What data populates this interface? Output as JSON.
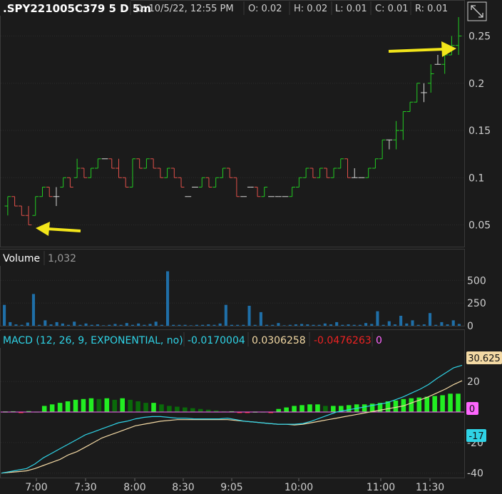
{
  "header": {
    "symbol": ".SPY221005C379 5 D 5m",
    "date": "D: 10/5/22, 12:55 PM",
    "open": "O: 0.02",
    "high": "H: 0.02",
    "low": "L: 0.01",
    "close": "C: 0.01",
    "range": "R: 0.01"
  },
  "volume_header": {
    "label": "Volume",
    "value": "1,032"
  },
  "macd_header": {
    "label": "MACD (12, 26, 9, EXPONENTIAL, no)",
    "value": "-0.0170004",
    "avg": "0.0306258",
    "diff": "-0.0476263",
    "zero": "0"
  },
  "macd_badges": {
    "top": "30.625",
    "zero": "0",
    "bottom": "-17"
  },
  "x_ticks": [
    "7:00",
    "7:30",
    "8:00",
    "8:30",
    "9:05",
    "10:00",
    "11:00",
    "11:30"
  ],
  "colors": {
    "up": "#22cc22",
    "down": "#e0504a",
    "neutral": "#d8d8d8",
    "volume": "#1f6fa8",
    "macd_value": "#2fd3e6",
    "macd_avg": "#f3d9a4",
    "arrow": "#f2e51a",
    "hist_pos": "#22ee22",
    "hist_pos_fall": "#0a6a0a",
    "hist_neg": "#ee2222",
    "zero_line": "#ff66ff"
  },
  "chart_data": [
    {
      "type": "candlestick",
      "name": "price",
      "ylim": [
        0.03,
        0.27
      ],
      "yticks": [
        0.05,
        0.1,
        0.15,
        0.2,
        0.25
      ],
      "bars": [
        {
          "o": 0.07,
          "h": 0.08,
          "l": 0.06,
          "c": 0.08
        },
        {
          "o": 0.08,
          "h": 0.08,
          "l": 0.07,
          "c": 0.07
        },
        {
          "o": 0.07,
          "h": 0.07,
          "l": 0.06,
          "c": 0.06
        },
        {
          "o": 0.06,
          "h": 0.07,
          "l": 0.05,
          "c": 0.05
        },
        {
          "o": 0.06,
          "h": 0.08,
          "l": 0.06,
          "c": 0.08
        },
        {
          "o": 0.08,
          "h": 0.09,
          "l": 0.08,
          "c": 0.09
        },
        {
          "o": 0.09,
          "h": 0.09,
          "l": 0.08,
          "c": 0.08
        },
        {
          "o": 0.08,
          "h": 0.09,
          "l": 0.07,
          "c": 0.08
        },
        {
          "o": 0.09,
          "h": 0.1,
          "l": 0.09,
          "c": 0.1
        },
        {
          "o": 0.1,
          "h": 0.1,
          "l": 0.09,
          "c": 0.09
        },
        {
          "o": 0.1,
          "h": 0.12,
          "l": 0.1,
          "c": 0.11
        },
        {
          "o": 0.11,
          "h": 0.11,
          "l": 0.1,
          "c": 0.1
        },
        {
          "o": 0.1,
          "h": 0.11,
          "l": 0.1,
          "c": 0.11
        },
        {
          "o": 0.11,
          "h": 0.12,
          "l": 0.11,
          "c": 0.12
        },
        {
          "o": 0.12,
          "h": 0.12,
          "l": 0.12,
          "c": 0.12
        },
        {
          "o": 0.12,
          "h": 0.12,
          "l": 0.11,
          "c": 0.11
        },
        {
          "o": 0.11,
          "h": 0.12,
          "l": 0.1,
          "c": 0.1
        },
        {
          "o": 0.1,
          "h": 0.1,
          "l": 0.09,
          "c": 0.09
        },
        {
          "o": 0.09,
          "h": 0.12,
          "l": 0.09,
          "c": 0.12
        },
        {
          "o": 0.12,
          "h": 0.12,
          "l": 0.11,
          "c": 0.11
        },
        {
          "o": 0.11,
          "h": 0.12,
          "l": 0.11,
          "c": 0.12
        },
        {
          "o": 0.12,
          "h": 0.12,
          "l": 0.11,
          "c": 0.11
        },
        {
          "o": 0.11,
          "h": 0.11,
          "l": 0.1,
          "c": 0.1
        },
        {
          "o": 0.1,
          "h": 0.11,
          "l": 0.1,
          "c": 0.11
        },
        {
          "o": 0.11,
          "h": 0.11,
          "l": 0.1,
          "c": 0.1
        },
        {
          "o": 0.1,
          "h": 0.1,
          "l": 0.09,
          "c": 0.09
        },
        {
          "o": 0.08,
          "h": 0.08,
          "l": 0.08,
          "c": 0.08
        },
        {
          "o": 0.09,
          "h": 0.09,
          "l": 0.09,
          "c": 0.09
        },
        {
          "o": 0.09,
          "h": 0.1,
          "l": 0.09,
          "c": 0.1
        },
        {
          "o": 0.1,
          "h": 0.1,
          "l": 0.09,
          "c": 0.09
        },
        {
          "o": 0.09,
          "h": 0.1,
          "l": 0.09,
          "c": 0.1
        },
        {
          "o": 0.1,
          "h": 0.11,
          "l": 0.1,
          "c": 0.11
        },
        {
          "o": 0.11,
          "h": 0.11,
          "l": 0.1,
          "c": 0.1
        },
        {
          "o": 0.1,
          "h": 0.1,
          "l": 0.08,
          "c": 0.08
        },
        {
          "o": 0.08,
          "h": 0.08,
          "l": 0.08,
          "c": 0.08
        },
        {
          "o": 0.09,
          "h": 0.09,
          "l": 0.09,
          "c": 0.09
        },
        {
          "o": 0.09,
          "h": 0.09,
          "l": 0.08,
          "c": 0.08
        },
        {
          "o": 0.08,
          "h": 0.09,
          "l": 0.08,
          "c": 0.09
        },
        {
          "o": 0.08,
          "h": 0.08,
          "l": 0.08,
          "c": 0.08
        },
        {
          "o": 0.08,
          "h": 0.08,
          "l": 0.08,
          "c": 0.08
        },
        {
          "o": 0.08,
          "h": 0.08,
          "l": 0.08,
          "c": 0.08
        },
        {
          "o": 0.08,
          "h": 0.09,
          "l": 0.08,
          "c": 0.09
        },
        {
          "o": 0.09,
          "h": 0.1,
          "l": 0.09,
          "c": 0.1
        },
        {
          "o": 0.1,
          "h": 0.11,
          "l": 0.1,
          "c": 0.11
        },
        {
          "o": 0.11,
          "h": 0.11,
          "l": 0.1,
          "c": 0.1
        },
        {
          "o": 0.1,
          "h": 0.11,
          "l": 0.1,
          "c": 0.11
        },
        {
          "o": 0.11,
          "h": 0.11,
          "l": 0.1,
          "c": 0.1
        },
        {
          "o": 0.1,
          "h": 0.11,
          "l": 0.1,
          "c": 0.11
        },
        {
          "o": 0.11,
          "h": 0.12,
          "l": 0.11,
          "c": 0.12
        },
        {
          "o": 0.12,
          "h": 0.12,
          "l": 0.1,
          "c": 0.1
        },
        {
          "o": 0.1,
          "h": 0.11,
          "l": 0.1,
          "c": 0.1
        },
        {
          "o": 0.1,
          "h": 0.1,
          "l": 0.1,
          "c": 0.1
        },
        {
          "o": 0.1,
          "h": 0.11,
          "l": 0.1,
          "c": 0.11
        },
        {
          "o": 0.11,
          "h": 0.12,
          "l": 0.11,
          "c": 0.12
        },
        {
          "o": 0.12,
          "h": 0.14,
          "l": 0.12,
          "c": 0.14
        },
        {
          "o": 0.14,
          "h": 0.14,
          "l": 0.13,
          "c": 0.14
        },
        {
          "o": 0.14,
          "h": 0.16,
          "l": 0.13,
          "c": 0.15
        },
        {
          "o": 0.15,
          "h": 0.17,
          "l": 0.14,
          "c": 0.17
        },
        {
          "o": 0.17,
          "h": 0.18,
          "l": 0.17,
          "c": 0.18
        },
        {
          "o": 0.18,
          "h": 0.2,
          "l": 0.18,
          "c": 0.2
        },
        {
          "o": 0.19,
          "h": 0.2,
          "l": 0.18,
          "c": 0.19
        },
        {
          "o": 0.2,
          "h": 0.22,
          "l": 0.19,
          "c": 0.21
        },
        {
          "o": 0.22,
          "h": 0.23,
          "l": 0.22,
          "c": 0.22
        },
        {
          "o": 0.22,
          "h": 0.24,
          "l": 0.21,
          "c": 0.23
        },
        {
          "o": 0.23,
          "h": 0.25,
          "l": 0.23,
          "c": 0.24
        },
        {
          "o": 0.24,
          "h": 0.27,
          "l": 0.23,
          "c": 0.25
        }
      ]
    },
    {
      "type": "bar",
      "name": "Volume",
      "ylim": [
        0,
        620
      ],
      "yticks": [
        0,
        250,
        500
      ],
      "values": [
        230,
        40,
        15,
        10,
        35,
        350,
        10,
        60,
        15,
        40,
        25,
        10,
        45,
        10,
        25,
        10,
        15,
        5,
        10,
        20,
        10,
        30,
        10,
        25,
        10,
        20,
        45,
        10,
        600,
        10,
        10,
        10,
        5,
        10,
        10,
        15,
        10,
        25,
        230,
        10,
        10,
        10,
        220,
        10,
        150,
        10,
        10,
        30,
        5,
        10,
        15,
        20,
        15,
        10,
        10,
        25,
        15,
        40,
        10,
        15,
        10,
        10,
        30,
        20,
        160,
        10,
        50,
        15,
        110,
        25,
        60,
        10,
        15,
        140,
        10,
        40,
        15,
        60,
        20
      ]
    },
    {
      "type": "line",
      "name": "MACD (12, 26, 9, EXPONENTIAL, no)",
      "ylim": [
        -42,
        42
      ],
      "yticks": [
        -40,
        -20,
        0,
        20
      ],
      "series": [
        {
          "name": "Value",
          "values": [
            -40,
            -39,
            -38,
            -37,
            -34,
            -30,
            -27,
            -24,
            -21,
            -18,
            -15,
            -13,
            -11,
            -9,
            -7,
            -6,
            -4.5,
            -3.5,
            -3,
            -3,
            -3.5,
            -4,
            -4,
            -4.5,
            -4.5,
            -4.5,
            -4.5,
            -4,
            -5,
            -6,
            -6.5,
            -7,
            -7.5,
            -8,
            -8,
            -8,
            -7.5,
            -6,
            -4,
            -2,
            0,
            1,
            2,
            3,
            4,
            5,
            6,
            8,
            10,
            12.5,
            15,
            18,
            22,
            25.5,
            29,
            30.625
          ]
        },
        {
          "name": "Avg",
          "values": [
            -40,
            -39.5,
            -39,
            -38.5,
            -37,
            -35,
            -33,
            -31,
            -28,
            -26,
            -23,
            -20,
            -17,
            -15,
            -13,
            -11,
            -9,
            -8,
            -7,
            -6,
            -5.5,
            -5,
            -5,
            -5,
            -5,
            -5,
            -5,
            -5,
            -5.5,
            -6,
            -6.5,
            -7,
            -7.5,
            -8,
            -8,
            -8.5,
            -8,
            -7,
            -6,
            -5,
            -4,
            -3,
            -2,
            -1,
            0,
            1,
            2,
            3,
            4,
            6,
            8,
            10,
            12.5,
            15,
            18,
            20.5
          ]
        }
      ],
      "histogram": [
        0.4,
        0.5,
        -0.4,
        0.6,
        0.3,
        4,
        5,
        6,
        7,
        8,
        8.5,
        9,
        8.5,
        9,
        8,
        9,
        8,
        7,
        6,
        6,
        5,
        4,
        3.5,
        3,
        2.5,
        2,
        1.5,
        1,
        0.5,
        0.5,
        -0.5,
        -0.4,
        0.3,
        0.2,
        -0.3,
        2,
        3,
        4,
        4.5,
        5,
        5,
        4,
        4,
        4,
        4.5,
        5,
        5,
        5.5,
        6,
        7,
        7.5,
        8.5,
        9,
        9.5,
        10,
        10.5,
        11,
        12,
        12
      ]
    }
  ]
}
